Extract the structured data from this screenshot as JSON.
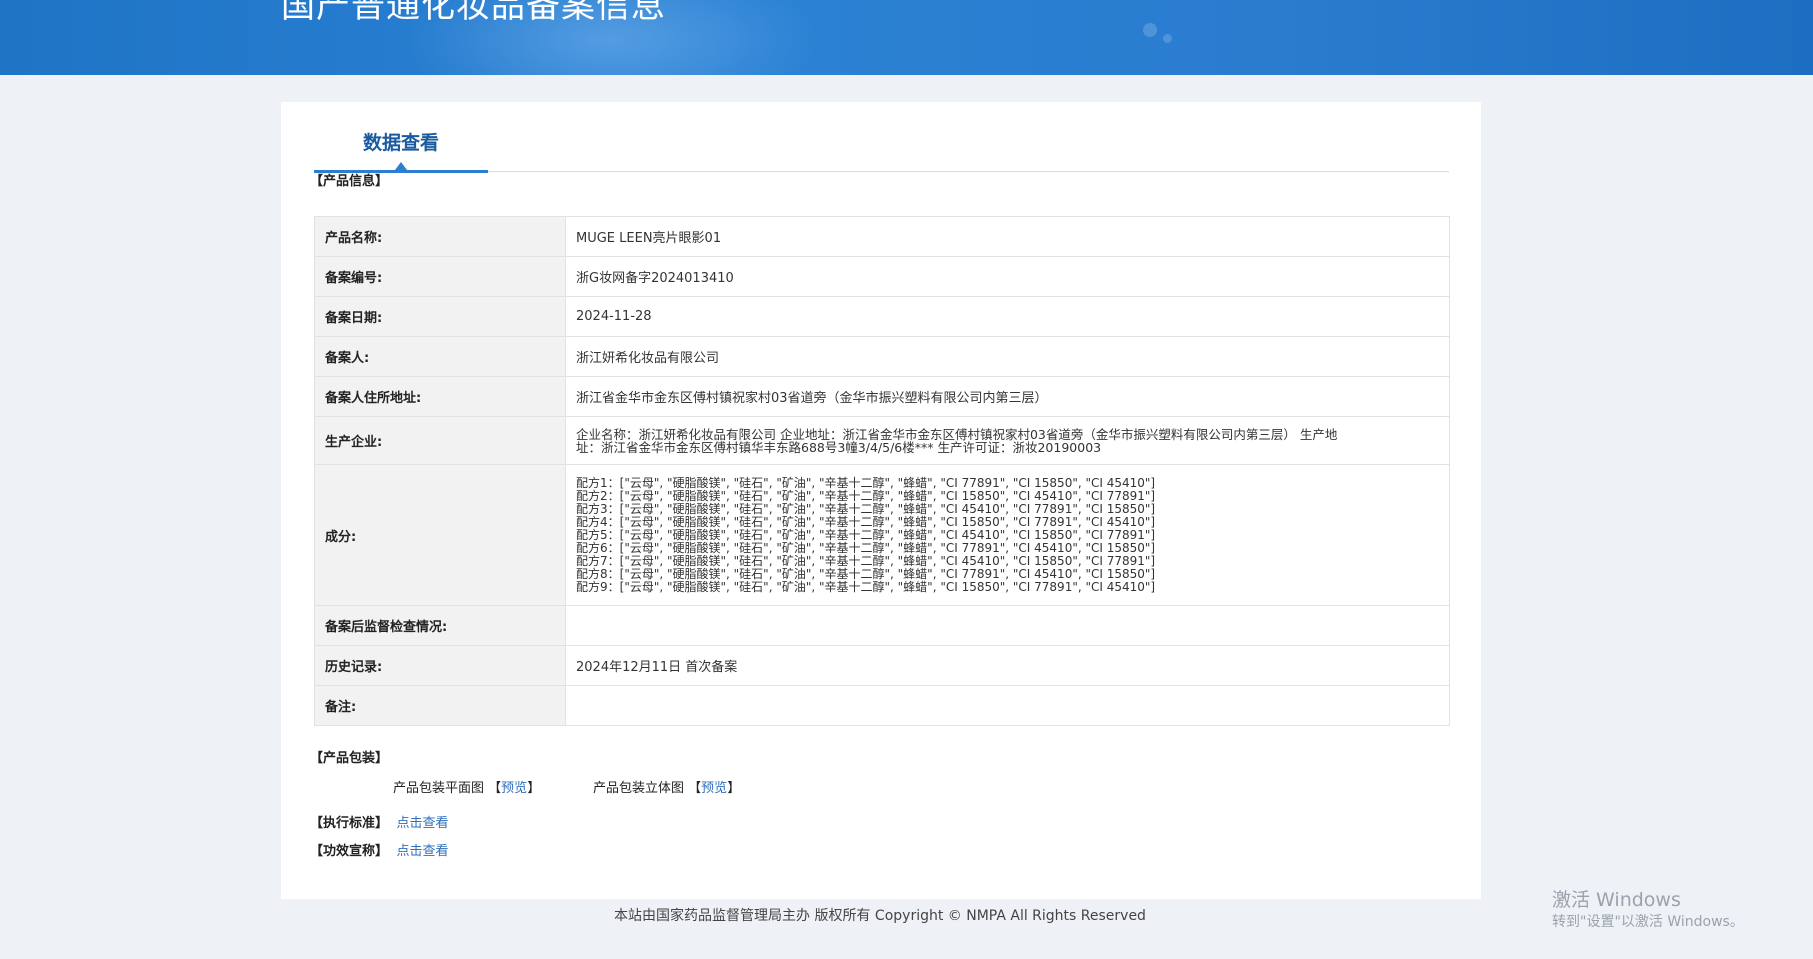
{
  "header": {
    "title": "国产普通化妆品备案信息"
  },
  "tab": {
    "label": "数据查看"
  },
  "sections": {
    "product_info": "【产品信息】",
    "packaging": "【产品包装】",
    "standard": "【执行标准】",
    "claims": "【功效宣称】"
  },
  "product": {
    "rows": [
      {
        "label": "产品名称:",
        "value": "MUGE LEEN亮片眼影01"
      },
      {
        "label": "备案编号:",
        "value": "浙G妆网备字2024013410"
      },
      {
        "label": "备案日期:",
        "value": "2024-11-28"
      },
      {
        "label": "备案人:",
        "value": "浙江妍希化妆品有限公司"
      },
      {
        "label": "备案人住所地址:",
        "value": "浙江省金华市金东区傅村镇祝家村03省道旁（金华市振兴塑料有限公司内第三层）"
      }
    ],
    "manufacturer": {
      "label": "生产企业:",
      "line1": "企业名称：浙江妍希化妆品有限公司 企业地址：浙江省金华市金东区傅村镇祝家村03省道旁（金华市振兴塑料有限公司内第三层） 生产地",
      "line2": "址：浙江省金华市金东区傅村镇华丰东路688号3幢3/4/5/6楼*** 生产许可证：浙妆20190003"
    },
    "ingredients": {
      "label": "成分:",
      "lines": [
        "配方1：[\"云母\", \"硬脂酸镁\", \"硅石\", \"矿油\", \"辛基十二醇\", \"蜂蜡\", \"CI 77891\", \"CI 15850\", \"CI 45410\"]",
        "配方2：[\"云母\", \"硬脂酸镁\", \"硅石\", \"矿油\", \"辛基十二醇\", \"蜂蜡\", \"CI 15850\", \"CI 45410\", \"CI 77891\"]",
        "配方3：[\"云母\", \"硬脂酸镁\", \"硅石\", \"矿油\", \"辛基十二醇\", \"蜂蜡\", \"CI 45410\", \"CI 77891\", \"CI 15850\"]",
        "配方4：[\"云母\", \"硬脂酸镁\", \"硅石\", \"矿油\", \"辛基十二醇\", \"蜂蜡\", \"CI 15850\", \"CI 77891\", \"CI 45410\"]",
        "配方5：[\"云母\", \"硬脂酸镁\", \"硅石\", \"矿油\", \"辛基十二醇\", \"蜂蜡\", \"CI 45410\", \"CI 15850\", \"CI 77891\"]",
        "配方6：[\"云母\", \"硬脂酸镁\", \"硅石\", \"矿油\", \"辛基十二醇\", \"蜂蜡\", \"CI 77891\", \"CI 45410\", \"CI 15850\"]",
        "配方7：[\"云母\", \"硬脂酸镁\", \"硅石\", \"矿油\", \"辛基十二醇\", \"蜂蜡\", \"CI 45410\", \"CI 15850\", \"CI 77891\"]",
        "配方8：[\"云母\", \"硬脂酸镁\", \"硅石\", \"矿油\", \"辛基十二醇\", \"蜂蜡\", \"CI 77891\", \"CI 45410\", \"CI 15850\"]",
        "配方9：[\"云母\", \"硬脂酸镁\", \"硅石\", \"矿油\", \"辛基十二醇\", \"蜂蜡\", \"CI 15850\", \"CI 77891\", \"CI 45410\"]"
      ]
    },
    "inspection": {
      "label": "备案后监督检查情况:",
      "value": ""
    },
    "history": {
      "label": "历史记录:",
      "value": "2024年12月11日 首次备案"
    },
    "remarks": {
      "label": "备注:",
      "value": ""
    }
  },
  "packaging": {
    "flat_label": "产品包装平面图",
    "flat_link": "预览",
    "solid_label": "产品包装立体图",
    "solid_link": "预览"
  },
  "links": {
    "standard": "点击查看",
    "claims": "点击查看"
  },
  "footer": {
    "text": "本站由国家药品监督管理局主办 版权所有 Copyright © NMPA All Rights Reserved"
  },
  "watermark": {
    "line1": "激活 Windows",
    "line2": "转到\"设置\"以激活 Windows。"
  },
  "colors": {
    "header_blue": "#2b82d4",
    "link_blue": "#2f6ebc",
    "tab_blue": "#1a5a9e"
  }
}
